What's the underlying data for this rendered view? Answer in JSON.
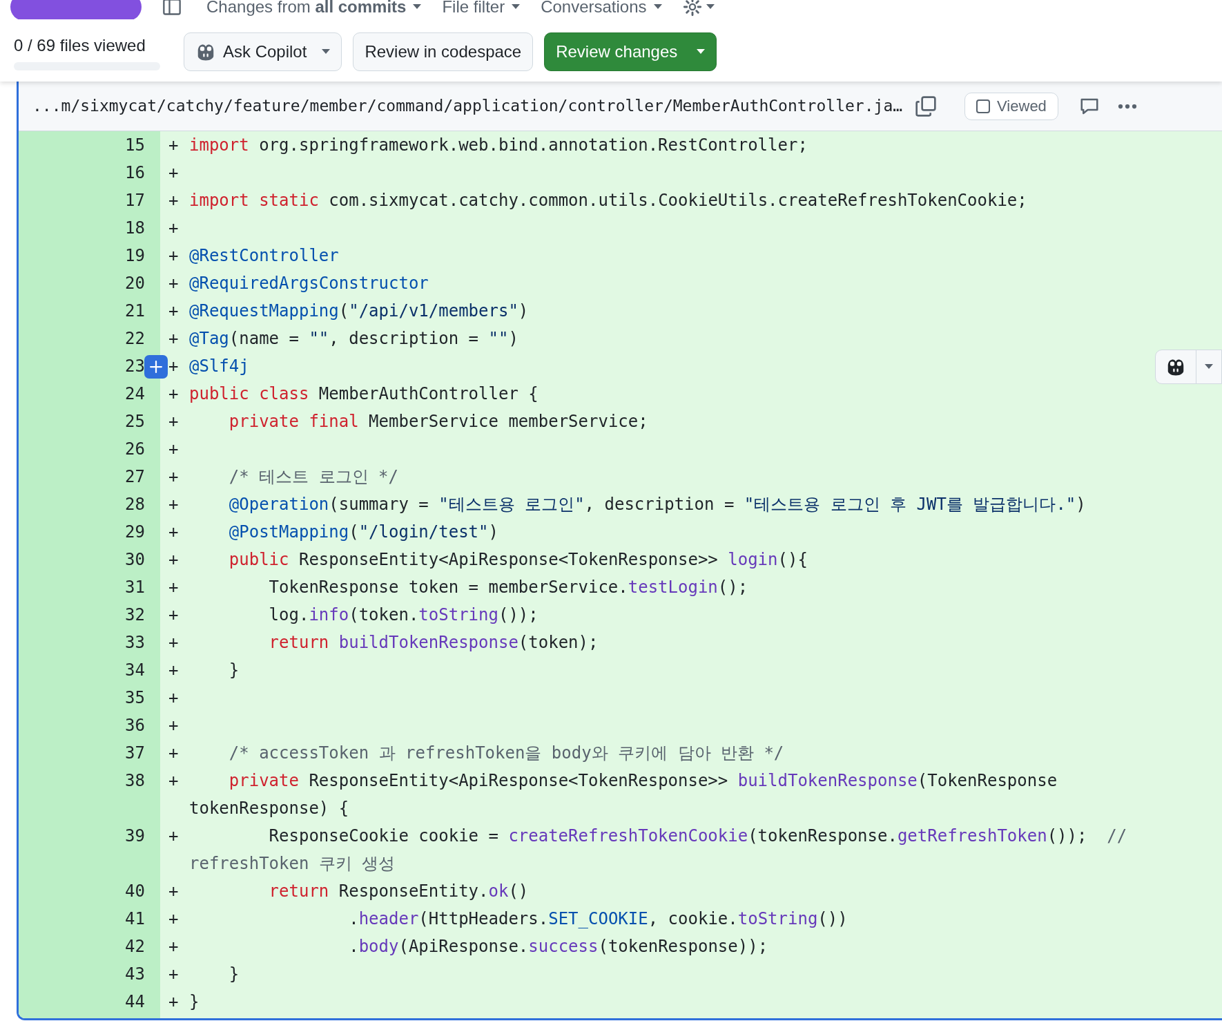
{
  "toolbar": {
    "filters": [
      {
        "label": "Changes from **all commits**"
      },
      {
        "label": "File filter"
      },
      {
        "label": "Conversations"
      }
    ]
  },
  "progress": {
    "label": "0 / 69 files viewed",
    "level": 0
  },
  "actions": [
    {
      "kind": "copilot",
      "label": "Ask Copilot"
    },
    {
      "kind": "plain",
      "label": "Review in codespace"
    },
    {
      "kind": "primary",
      "label": "Review changes"
    }
  ],
  "file": {
    "path": "...m/sixmycat/catchy/feature/member/command/application/controller/MemberAuthController.ja…",
    "viewed": {
      "label": "Viewed",
      "checked": false
    },
    "lines": [
      {
        "number": "15",
        "marker": "+",
        "hovered": false,
        "segments": [
          {
            "kind": "keyword",
            "text": "import"
          },
          {
            "kind": "plain",
            "text": " org.springframework.web.bind.annotation.RestController;"
          }
        ]
      },
      {
        "number": "16",
        "marker": "+",
        "hovered": false
      },
      {
        "number": "17",
        "marker": "+",
        "hovered": false,
        "segments": [
          {
            "kind": "keyword",
            "text": "import"
          },
          {
            "kind": "keyword",
            "text": " static"
          },
          {
            "kind": "plain",
            "text": " com.sixmycat.catchy.common.utils.CookieUtils.createRefreshTokenCookie;"
          }
        ]
      },
      {
        "number": "18",
        "marker": "+",
        "hovered": false
      },
      {
        "number": "19",
        "marker": "+",
        "hovered": false,
        "segments": [
          {
            "kind": "annotation",
            "text": "@RestController"
          }
        ]
      },
      {
        "number": "20",
        "marker": "+",
        "hovered": false,
        "segments": [
          {
            "kind": "annotation",
            "text": "@RequiredArgsConstructor"
          }
        ]
      },
      {
        "number": "21",
        "marker": "+",
        "hovered": false,
        "segments": [
          {
            "kind": "annotation",
            "text": "@RequestMapping"
          },
          {
            "kind": "plain",
            "text": "("
          },
          {
            "kind": "string",
            "text": "\"/api/v1/members\""
          },
          {
            "kind": "plain",
            "text": ")"
          }
        ]
      },
      {
        "number": "22",
        "marker": "+",
        "hovered": false,
        "segments": [
          {
            "kind": "annotation",
            "text": "@Tag"
          },
          {
            "kind": "plain",
            "text": "(name = "
          },
          {
            "kind": "string",
            "text": "\"\""
          },
          {
            "kind": "plain",
            "text": ", description = "
          },
          {
            "kind": "string",
            "text": "\"\""
          },
          {
            "kind": "plain",
            "text": ")"
          }
        ]
      },
      {
        "number": "23",
        "marker": "+",
        "hovered": true,
        "segments": [
          {
            "kind": "annotation",
            "text": "@Slf4j"
          }
        ]
      },
      {
        "number": "24",
        "marker": "+",
        "hovered": false,
        "segments": [
          {
            "kind": "keyword",
            "text": "public"
          },
          {
            "kind": "keyword",
            "text": " class"
          },
          {
            "kind": "plain",
            "text": " MemberAuthController {"
          }
        ]
      },
      {
        "number": "25",
        "marker": "+",
        "hovered": false,
        "segments": [
          {
            "kind": "keyword",
            "text": "    private"
          },
          {
            "kind": "keyword",
            "text": " final"
          },
          {
            "kind": "plain",
            "text": " MemberService memberService;"
          }
        ]
      },
      {
        "number": "26",
        "marker": "+",
        "hovered": false
      },
      {
        "number": "27",
        "marker": "+",
        "hovered": false,
        "segments": [
          {
            "kind": "comment",
            "text": "    /* 테스트 로그인 */"
          }
        ]
      },
      {
        "number": "28",
        "marker": "+",
        "hovered": false,
        "segments": [
          {
            "kind": "annotation",
            "text": "    @Operation"
          },
          {
            "kind": "plain",
            "text": "(summary = "
          },
          {
            "kind": "string",
            "text": "\"테스트용 로그인\""
          },
          {
            "kind": "plain",
            "text": ", description = "
          },
          {
            "kind": "string",
            "text": "\"테스트용 로그인 후 JWT를 발급합니다.\""
          },
          {
            "kind": "plain",
            "text": ")"
          }
        ]
      },
      {
        "number": "29",
        "marker": "+",
        "hovered": false,
        "segments": [
          {
            "kind": "annotation",
            "text": "    @PostMapping"
          },
          {
            "kind": "plain",
            "text": "("
          },
          {
            "kind": "string",
            "text": "\"/login/test\""
          },
          {
            "kind": "plain",
            "text": ")"
          }
        ]
      },
      {
        "number": "30",
        "marker": "+",
        "hovered": false,
        "segments": [
          {
            "kind": "keyword",
            "text": "    public"
          },
          {
            "kind": "plain",
            "text": " ResponseEntity<ApiResponse<TokenResponse>> "
          },
          {
            "kind": "function",
            "text": "login"
          },
          {
            "kind": "plain",
            "text": "(){"
          }
        ]
      },
      {
        "number": "31",
        "marker": "+",
        "hovered": false,
        "segments": [
          {
            "kind": "plain",
            "text": "        TokenResponse token = memberService."
          },
          {
            "kind": "function",
            "text": "testLogin"
          },
          {
            "kind": "plain",
            "text": "();"
          }
        ]
      },
      {
        "number": "32",
        "marker": "+",
        "hovered": false,
        "segments": [
          {
            "kind": "plain",
            "text": "        log."
          },
          {
            "kind": "function",
            "text": "info"
          },
          {
            "kind": "plain",
            "text": "(token."
          },
          {
            "kind": "function",
            "text": "toString"
          },
          {
            "kind": "plain",
            "text": "());"
          }
        ]
      },
      {
        "number": "33",
        "marker": "+",
        "hovered": false,
        "segments": [
          {
            "kind": "keyword",
            "text": "        return"
          },
          {
            "kind": "function",
            "text": " buildTokenResponse"
          },
          {
            "kind": "plain",
            "text": "(token);"
          }
        ]
      },
      {
        "number": "34",
        "marker": "+",
        "hovered": false,
        "segments": [
          {
            "kind": "plain",
            "text": "    }"
          }
        ]
      },
      {
        "number": "35",
        "marker": "+",
        "hovered": false
      },
      {
        "number": "36",
        "marker": "+",
        "hovered": false
      },
      {
        "number": "37",
        "marker": "+",
        "hovered": false,
        "segments": [
          {
            "kind": "comment",
            "text": "    /* accessToken 과 refreshToken을 body와 쿠키에 담아 반환 */"
          }
        ]
      },
      {
        "number": "38",
        "marker": "+",
        "hovered": false,
        "segments": [
          {
            "kind": "keyword",
            "text": "    private"
          },
          {
            "kind": "plain",
            "text": " ResponseEntity<ApiResponse<TokenResponse>> "
          },
          {
            "kind": "function",
            "text": "buildTokenResponse"
          },
          {
            "kind": "plain",
            "text": "(TokenResponse tokenResponse) {"
          }
        ]
      },
      {
        "number": "39",
        "marker": "+",
        "hovered": false,
        "segments": [
          {
            "kind": "plain",
            "text": "        ResponseCookie cookie = "
          },
          {
            "kind": "function",
            "text": "createRefreshTokenCookie"
          },
          {
            "kind": "plain",
            "text": "(tokenResponse."
          },
          {
            "kind": "function",
            "text": "getRefreshToken"
          },
          {
            "kind": "plain",
            "text": "());"
          },
          {
            "kind": "comment",
            "text": "  // refreshToken 쿠키 생성"
          }
        ]
      },
      {
        "number": "40",
        "marker": "+",
        "hovered": false,
        "segments": [
          {
            "kind": "keyword",
            "text": "        return"
          },
          {
            "kind": "plain",
            "text": " ResponseEntity."
          },
          {
            "kind": "function",
            "text": "ok"
          },
          {
            "kind": "plain",
            "text": "()"
          }
        ]
      },
      {
        "number": "41",
        "marker": "+",
        "hovered": false,
        "segments": [
          {
            "kind": "plain",
            "text": "                ."
          },
          {
            "kind": "function",
            "text": "header"
          },
          {
            "kind": "plain",
            "text": "(HttpHeaders."
          },
          {
            "kind": "constant",
            "text": "SET_COOKIE"
          },
          {
            "kind": "plain",
            "text": ", cookie."
          },
          {
            "kind": "function",
            "text": "toString"
          },
          {
            "kind": "plain",
            "text": "())"
          }
        ]
      },
      {
        "number": "42",
        "marker": "+",
        "hovered": false,
        "segments": [
          {
            "kind": "plain",
            "text": "                ."
          },
          {
            "kind": "function",
            "text": "body"
          },
          {
            "kind": "plain",
            "text": "(ApiResponse."
          },
          {
            "kind": "function",
            "text": "success"
          },
          {
            "kind": "plain",
            "text": "(tokenResponse));"
          }
        ]
      },
      {
        "number": "43",
        "marker": "+",
        "hovered": false,
        "segments": [
          {
            "kind": "plain",
            "text": "    }"
          }
        ]
      },
      {
        "number": "44",
        "marker": "+",
        "hovered": false,
        "segments": [
          {
            "kind": "plain",
            "text": "}"
          }
        ]
      }
    ]
  }
}
